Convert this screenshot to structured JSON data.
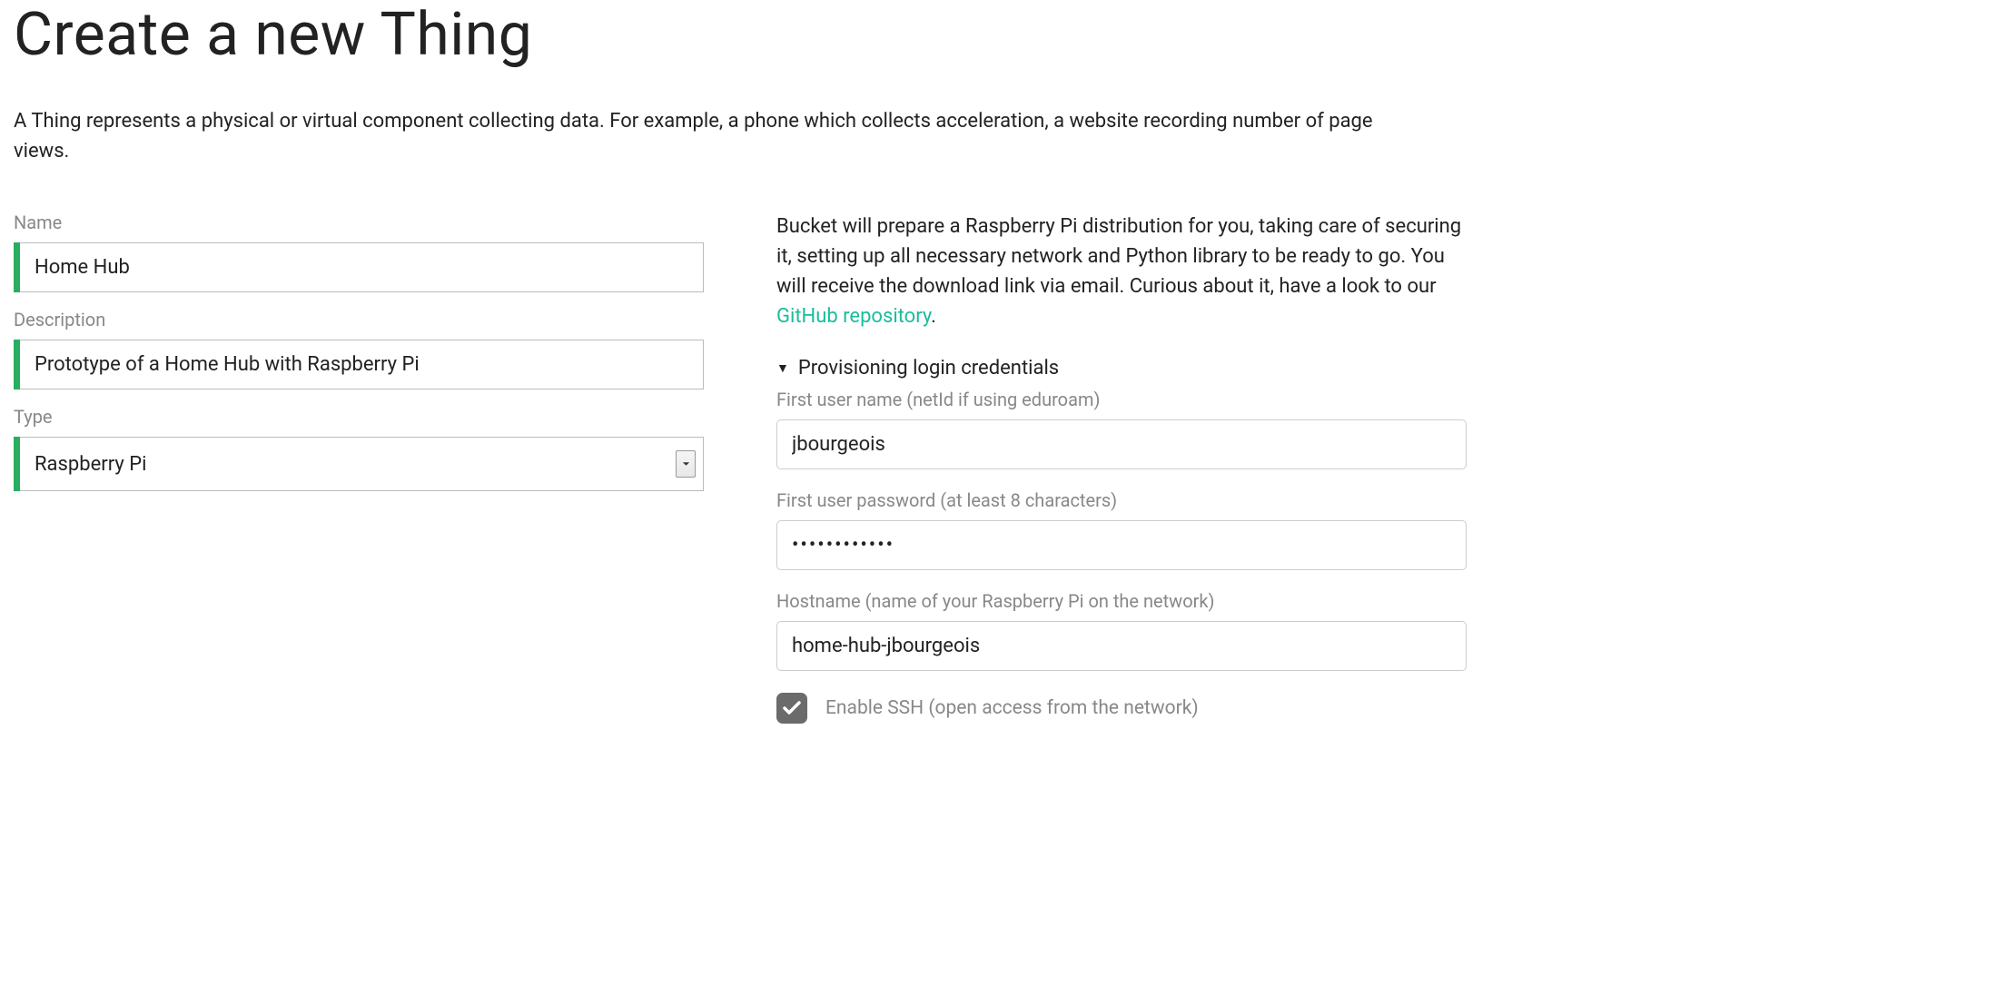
{
  "header": {
    "title": "Create a new Thing",
    "intro": "A Thing represents a physical or virtual component collecting data. For example, a phone which collects acceleration, a website recording number of page views."
  },
  "leftForm": {
    "name": {
      "label": "Name",
      "value": "Home Hub"
    },
    "description": {
      "label": "Description",
      "value": "Prototype of a Home Hub with Raspberry Pi"
    },
    "type": {
      "label": "Type",
      "value": "Raspberry Pi"
    }
  },
  "rightPanel": {
    "introPrefix": "Bucket will prepare a Raspberry Pi distribution for you, taking care of securing it, setting up all necessary network and Python library to be ready to go. You will receive the download link via email. Curious about it, have a look to our ",
    "linkText": "GitHub repository",
    "introSuffix": ".",
    "disclosureTitle": "Provisioning login credentials",
    "username": {
      "label": "First user name (netId if using eduroam)",
      "value": "jbourgeois"
    },
    "password": {
      "label": "First user password (at least 8 characters)",
      "value": "••••••••••••"
    },
    "hostname": {
      "label": "Hostname (name of your Raspberry Pi on the network)",
      "value": "home-hub-jbourgeois"
    },
    "ssh": {
      "label": "Enable SSH (open access from the network)",
      "checked": true
    }
  }
}
